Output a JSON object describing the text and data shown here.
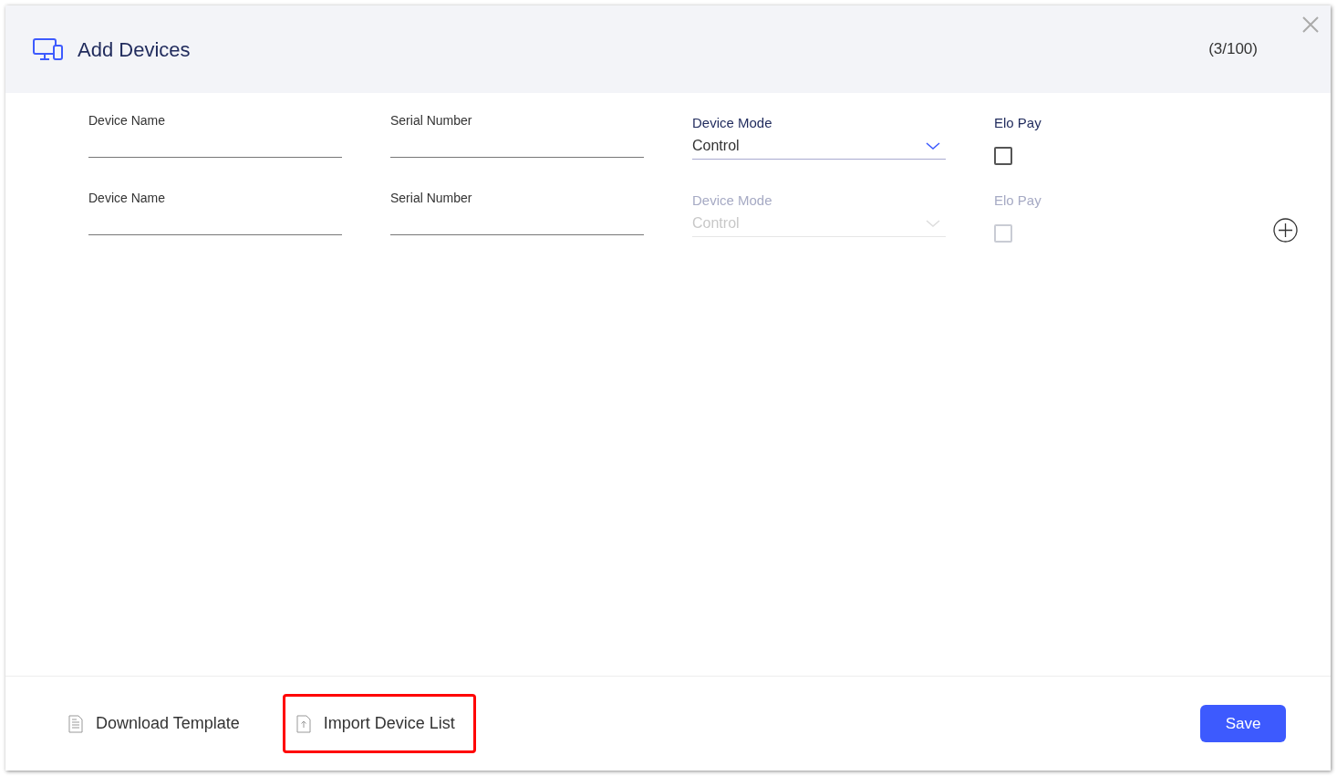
{
  "window": {
    "title": "Add Devices",
    "count": "(3/100)"
  },
  "rows": [
    {
      "device_name": {
        "label": "Device Name"
      },
      "serial_number": {
        "label": "Serial Number"
      },
      "device_mode": {
        "label": "Device Mode",
        "value": "Control",
        "disabled": false
      },
      "elo_pay": {
        "label": "Elo Pay",
        "checked": false,
        "disabled": false
      },
      "add_button": false
    },
    {
      "device_name": {
        "label": "Device Name"
      },
      "serial_number": {
        "label": "Serial Number"
      },
      "device_mode": {
        "label": "Device Mode",
        "value": "Control",
        "disabled": true
      },
      "elo_pay": {
        "label": "Elo Pay",
        "checked": false,
        "disabled": true
      },
      "add_button": true
    }
  ],
  "footer": {
    "links": [
      {
        "kind": "download",
        "label": "Download Template",
        "highlighted": false
      },
      {
        "kind": "import",
        "label": "Import Device List",
        "highlighted": true
      }
    ],
    "save": "Save"
  }
}
